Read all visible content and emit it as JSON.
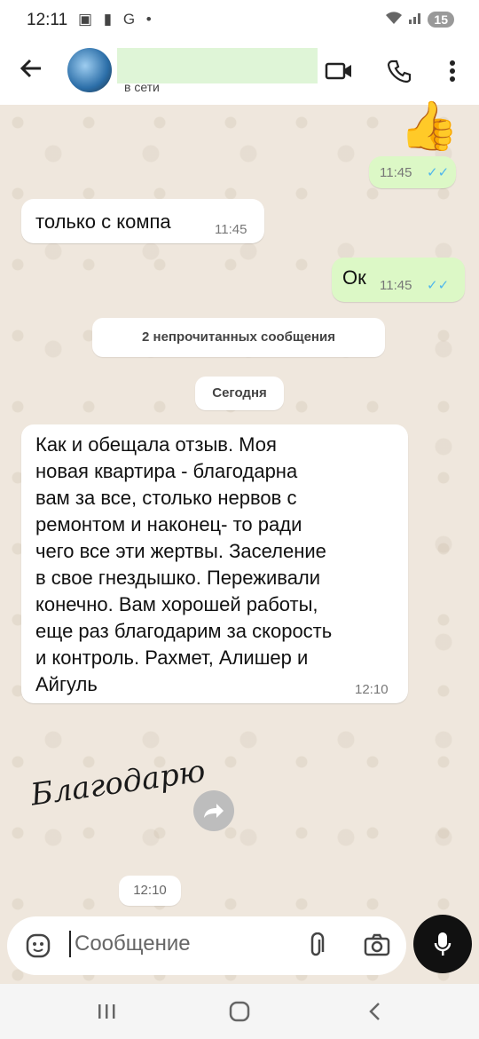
{
  "status_bar": {
    "time": "12:11",
    "left_icons": "▣ ▮ G •",
    "battery": "15"
  },
  "header": {
    "contact_status": "в сети"
  },
  "messages": [
    {
      "time": "11:45"
    },
    {
      "text": "только с компа",
      "time": "11:45"
    },
    {
      "text": "Ок",
      "time": "11:45"
    }
  ],
  "unread_banner": "2 непрочитанных сообщения",
  "date_separator": "Сегодня",
  "review": {
    "lines": [
      "Как и обещала отзыв. Моя",
      "новая квартира - благодарна",
      "вам за все, столько нервов с",
      "ремонтом и наконец- то ради",
      "чего все эти жертвы. Заселение",
      "в свое гнездышко. Переживали",
      "конечно. Вам хорошей работы,",
      "еще раз благодарим за скорость",
      "и контроль. Рахмет, Алишер  и",
      "Айгуль"
    ],
    "time": "12:10"
  },
  "sticker": {
    "text": "Благодарю",
    "time": "12:10"
  },
  "composer": {
    "placeholder": "Сообщение"
  },
  "colors": {
    "incoming": "#ffffff",
    "outgoing": "#dcf8c6",
    "read_ticks": "#4fb6ec"
  }
}
